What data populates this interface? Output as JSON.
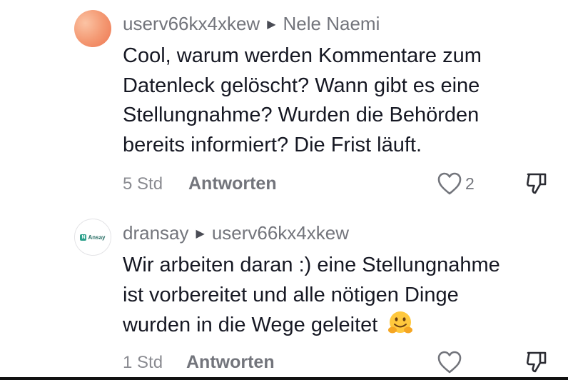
{
  "comments": [
    {
      "author": "userv66kx4xkew",
      "reply_to": "Nele  Naemi",
      "text_lines": [
        "Cool, warum werden Kommentare zum",
        "Datenleck gelöscht? Wann gibt es eine",
        "Stellungnahme? Wurden die Behörden",
        "bereits informiert? Die Frist läuft."
      ],
      "time": "5 Std",
      "reply_label": "Antworten",
      "like_count": "2",
      "avatar_color": "#f49a74"
    },
    {
      "author": "dransay",
      "reply_to": "userv66kx4xkew",
      "avatar_logo_text": "Ansay",
      "text_lines": [
        "Wir arbeiten daran :) eine Stellungnahme",
        "ist vorbereitet und alle nötigen Dinge",
        "wurden in die Wege geleitet"
      ],
      "emoji": "hugging-face-emoji",
      "time": "1 Std",
      "reply_label": "Antworten",
      "like_count": "",
      "avatar_color": "#2a9f8a"
    }
  ],
  "icons": {
    "reply_arrow": "play-arrow-icon",
    "like": "heart-outline-icon",
    "dislike": "thumbs-down-icon"
  }
}
